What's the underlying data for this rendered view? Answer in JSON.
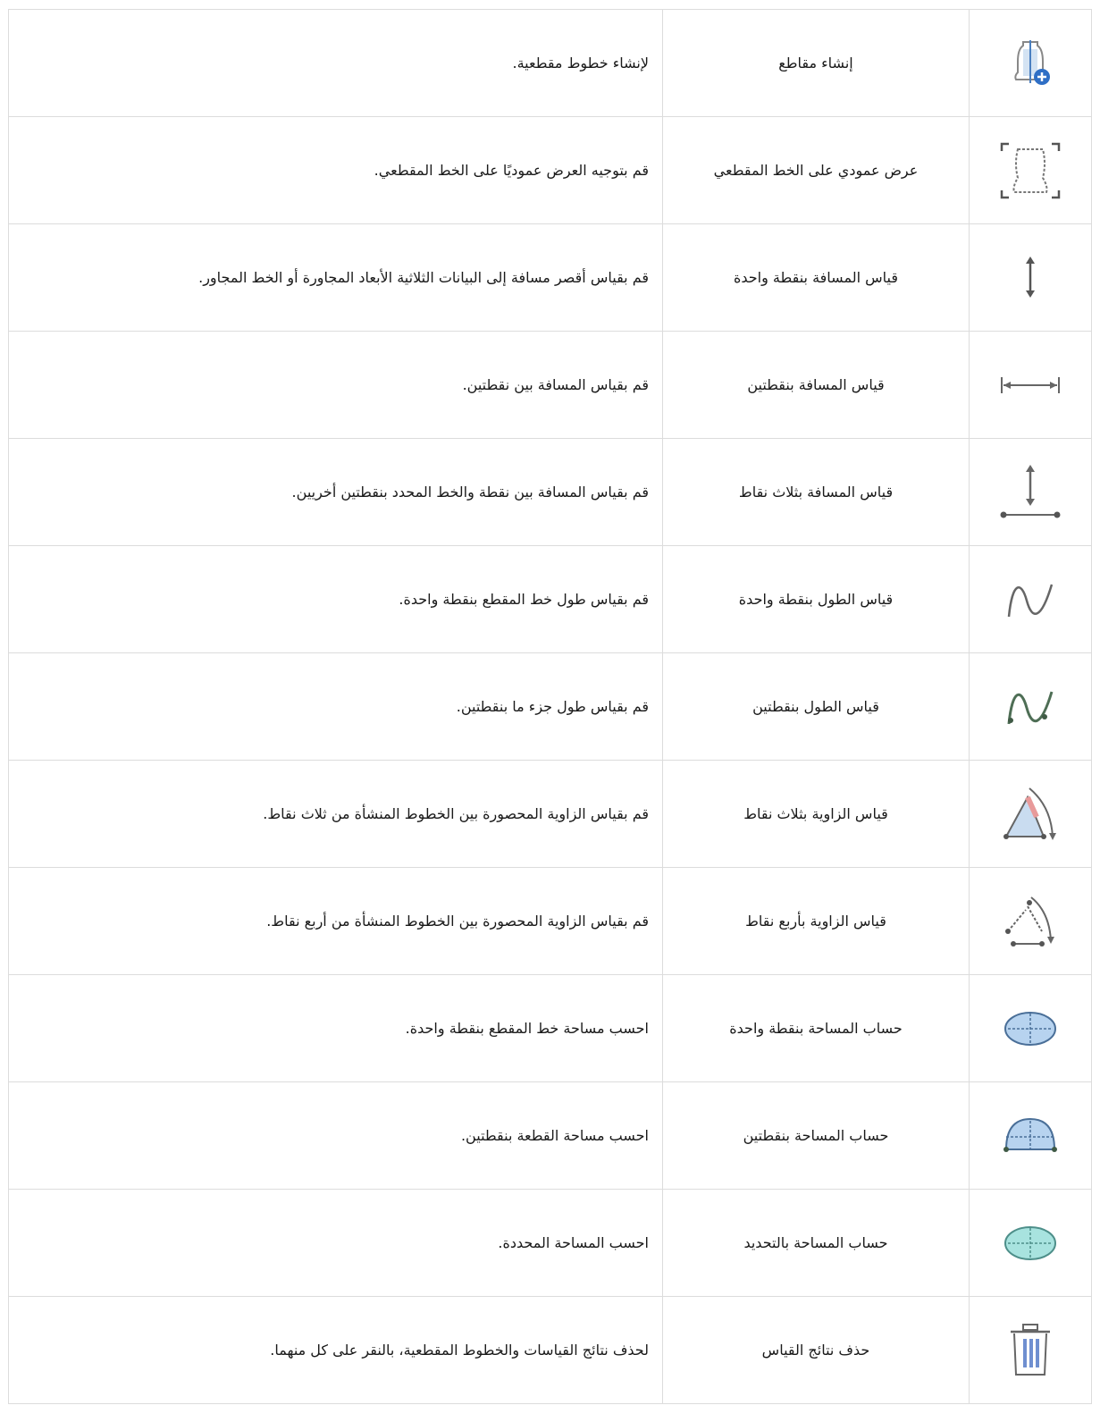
{
  "rows": [
    {
      "icon": "create-section-icon",
      "name": "إنشاء مقاطع",
      "desc": "لإنشاء خطوط مقطعية."
    },
    {
      "icon": "perpendicular-view-icon",
      "name": "عرض عمودي على الخط المقطعي",
      "desc": "قم بتوجيه العرض عموديًا على الخط المقطعي."
    },
    {
      "icon": "one-point-distance-icon",
      "name": "قياس المسافة بنقطة واحدة",
      "desc": "قم بقياس أقصر مسافة إلى البيانات الثلاثية الأبعاد المجاورة أو الخط المجاور."
    },
    {
      "icon": "two-point-distance-icon",
      "name": "قياس المسافة بنقطتين",
      "desc": "قم بقياس المسافة بين نقطتين."
    },
    {
      "icon": "three-point-distance-icon",
      "name": "قياس المسافة بثلاث نقاط",
      "desc": "قم بقياس المسافة بين نقطة والخط المحدد بنقطتين أخريين."
    },
    {
      "icon": "one-point-length-icon",
      "name": "قياس الطول بنقطة واحدة",
      "desc": "قم بقياس طول خط المقطع بنقطة واحدة."
    },
    {
      "icon": "two-point-length-icon",
      "name": "قياس الطول بنقطتين",
      "desc": "قم بقياس طول جزء ما بنقطتين."
    },
    {
      "icon": "three-point-angle-icon",
      "name": "قياس الزاوية بثلاث نقاط",
      "desc": "قم بقياس الزاوية المحصورة بين الخطوط المنشأة من ثلاث نقاط."
    },
    {
      "icon": "four-point-angle-icon",
      "name": "قياس الزاوية بأربع نقاط",
      "desc": "قم بقياس الزاوية المحصورة بين الخطوط المنشأة من أربع نقاط."
    },
    {
      "icon": "one-point-area-icon",
      "name": "حساب المساحة بنقطة واحدة",
      "desc": "احسب مساحة خط المقطع بنقطة واحدة."
    },
    {
      "icon": "two-point-area-icon",
      "name": "حساب المساحة بنقطتين",
      "desc": "احسب مساحة القطعة بنقطتين."
    },
    {
      "icon": "selection-area-icon",
      "name": "حساب المساحة بالتحديد",
      "desc": "احسب المساحة المحددة."
    },
    {
      "icon": "delete-measurements-icon",
      "name": "حذف نتائج القياس",
      "desc": "لحذف نتائج القياسات والخطوط المقطعية، بالنقر على كل منهما."
    }
  ]
}
